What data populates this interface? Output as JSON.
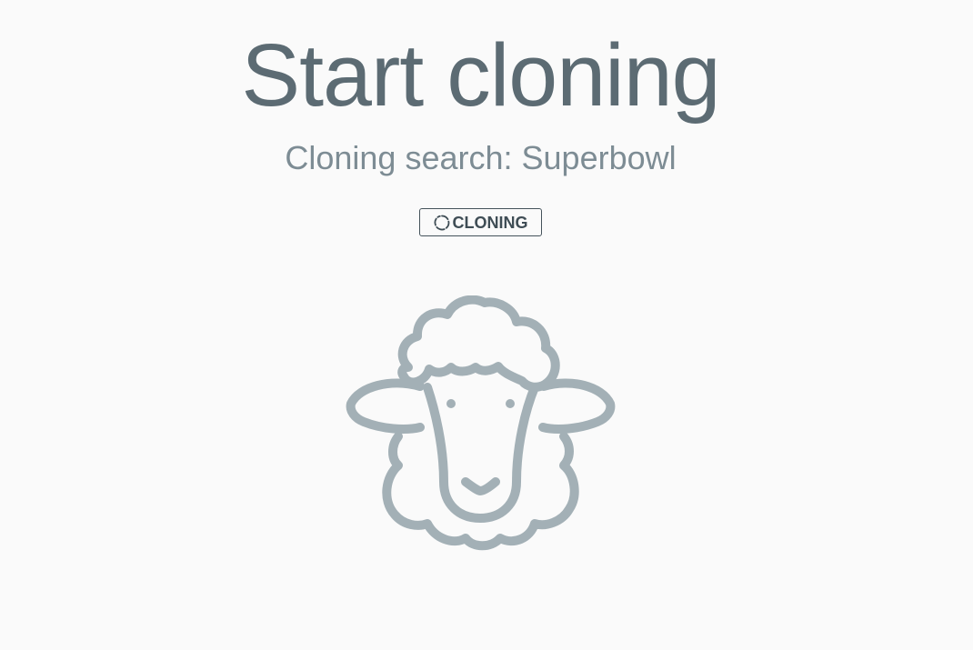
{
  "main": {
    "title": "Start cloning",
    "subtitle": "Cloning search: Superbowl",
    "status_button": {
      "label": "CLONING",
      "icon": "spinner-icon"
    },
    "illustration": {
      "icon": "sheep-icon"
    }
  },
  "colors": {
    "background": "#fafafa",
    "title": "#5c6b73",
    "subtitle": "#7d8c94",
    "button_border": "#44525a",
    "sheep_stroke": "#a3b0b6"
  }
}
